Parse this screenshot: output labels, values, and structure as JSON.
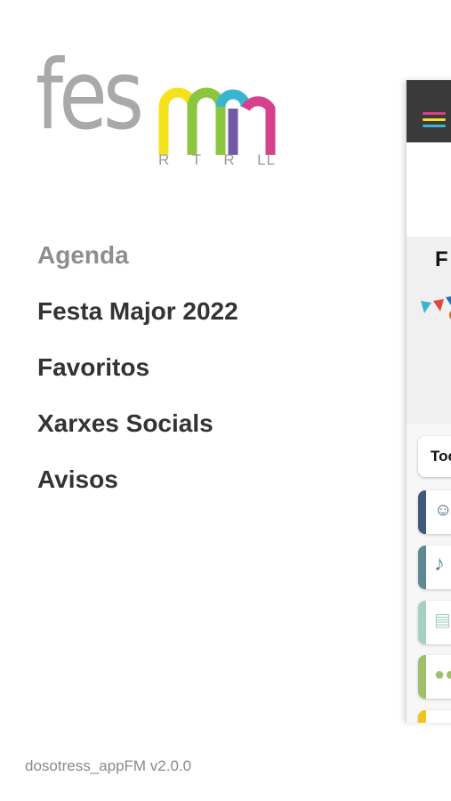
{
  "logo": {
    "main_text": "fes",
    "sub_letters": [
      "R",
      "T",
      "R",
      "LL"
    ],
    "arch_colors": [
      "#f4e21b",
      "#8cc63f",
      "#3ab5d0",
      "#6f5aa3",
      "#d6418e"
    ]
  },
  "menu": {
    "items": [
      {
        "label": "Agenda",
        "active": true
      },
      {
        "label": "Festa Major 2022",
        "active": false
      },
      {
        "label": "Favoritos",
        "active": false
      },
      {
        "label": "Xarxes Socials",
        "active": false
      },
      {
        "label": "Avisos",
        "active": false
      }
    ]
  },
  "footer": {
    "version": "dosotress_appFM v2.0.0"
  },
  "app_panel": {
    "header_bg": "#3a3a3a",
    "hamburger_colors": [
      "#d6418e",
      "#f4e21b",
      "#3ab5d0"
    ],
    "banner_letter": "F",
    "filter_button": "Toc",
    "categories": [
      {
        "icon": "theater-masks-icon",
        "glyph": "🎭",
        "color": "#3e5a78"
      },
      {
        "icon": "music-note-icon",
        "glyph": "♪",
        "color": "#5d8a92"
      },
      {
        "icon": "film-icon",
        "glyph": "🎞",
        "color": "#a6d1c0"
      },
      {
        "icon": "users-icon",
        "glyph": "👥",
        "color": "#9fbf6a"
      }
    ]
  }
}
